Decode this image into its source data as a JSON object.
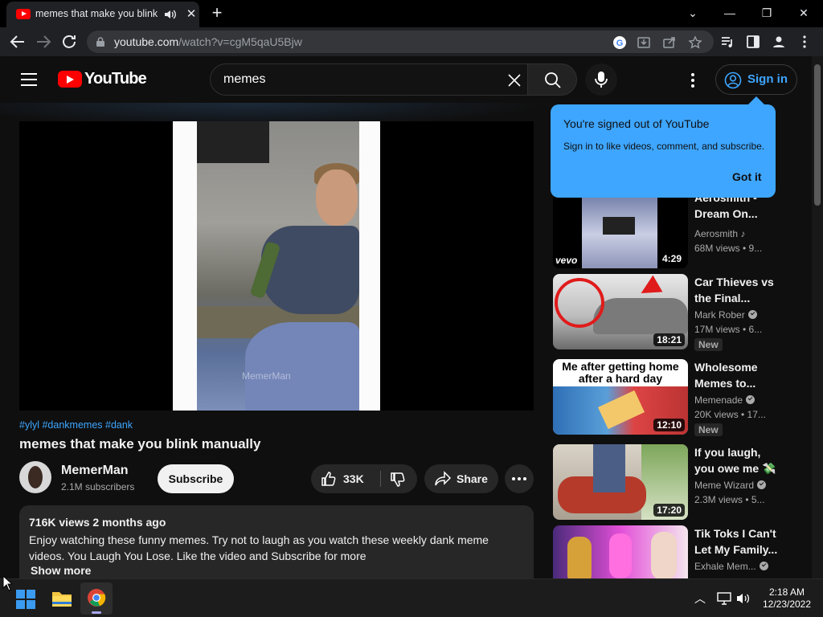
{
  "browser": {
    "tab_title": "memes that make you blink",
    "url_host": "youtube.com",
    "url_path": "/watch?v=cgM5qaU5Bjw"
  },
  "youtube": {
    "logo_text": "YouTube",
    "search_value": "memes",
    "signin_label": "Sign in"
  },
  "popup": {
    "title": "You're signed out of YouTube",
    "description": "Sign in to like videos, comment, and subscribe.",
    "button": "Got it"
  },
  "video": {
    "watermark": "MemerMan",
    "hashtags": "#ylyl #dankmemes #dank",
    "title": "memes that make you blink manually",
    "channel": "MemerMan",
    "subscribers": "2.1M subscribers",
    "subscribe_label": "Subscribe",
    "likes": "33K",
    "share_label": "Share",
    "views_date": "716K views  2 months ago",
    "description": "Enjoy watching these funny memes. Try not to laugh as you watch these weekly dank meme videos. You Laugh You Lose. Like the video and Subscribe for more",
    "show_more": "Show more"
  },
  "recommendations": [
    {
      "title": "Aerosmith - Dream On...",
      "channel": "Aerosmith",
      "views": "68M views • 9...",
      "duration": "4:29",
      "is_new": false,
      "brand": "vevo"
    },
    {
      "title": "Car Thieves vs the Final...",
      "channel": "Mark Rober",
      "views": "17M views • 6...",
      "duration": "18:21",
      "is_new": true,
      "new_label": "New"
    },
    {
      "title": "Wholesome Memes to...",
      "channel": "Memenade",
      "views": "20K views • 17...",
      "duration": "12:10",
      "is_new": true,
      "new_label": "New",
      "thumb_caption": "Me after getting home after a hard day"
    },
    {
      "title": "If you laugh, you owe me 💸",
      "channel": "Meme Wizard",
      "views": "2.3M views • 5...",
      "duration": "17:20",
      "is_new": false
    },
    {
      "title": "Tik Toks I Can't Let My Family...",
      "channel": "Exhale Mem...",
      "views": "",
      "duration": "",
      "is_new": false
    }
  ],
  "taskbar": {
    "time": "2:18 AM",
    "date": "12/23/2022"
  }
}
